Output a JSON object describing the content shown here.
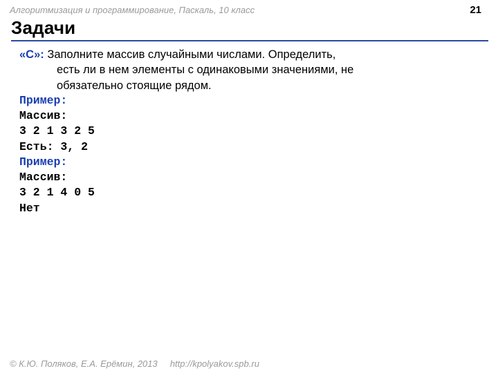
{
  "header": {
    "course": "Алгоритмизация и программирование, Паскаль, 10 класс",
    "page": "21"
  },
  "title": "Задачи",
  "task": {
    "label": "«С»:",
    "text_l1": "Заполните массив случайными числами. Определить,",
    "text_l2": "есть ли в нем элементы с одинаковыми значениями, не",
    "text_l3": "обязательно стоящие рядом."
  },
  "example1": {
    "label": "Пример:",
    "l1": "Массив:",
    "l2": "3 2 1 3 2 5",
    "l3": "Есть: 3, 2"
  },
  "example2": {
    "label": "Пример:",
    "l1": "Массив:",
    "l2": "3 2 1 4 0 5",
    "l3": "Нет"
  },
  "footer": {
    "copyright": "© К.Ю. Поляков, Е.А. Ерёмин, 2013",
    "url": "http://kpolyakov.spb.ru"
  }
}
